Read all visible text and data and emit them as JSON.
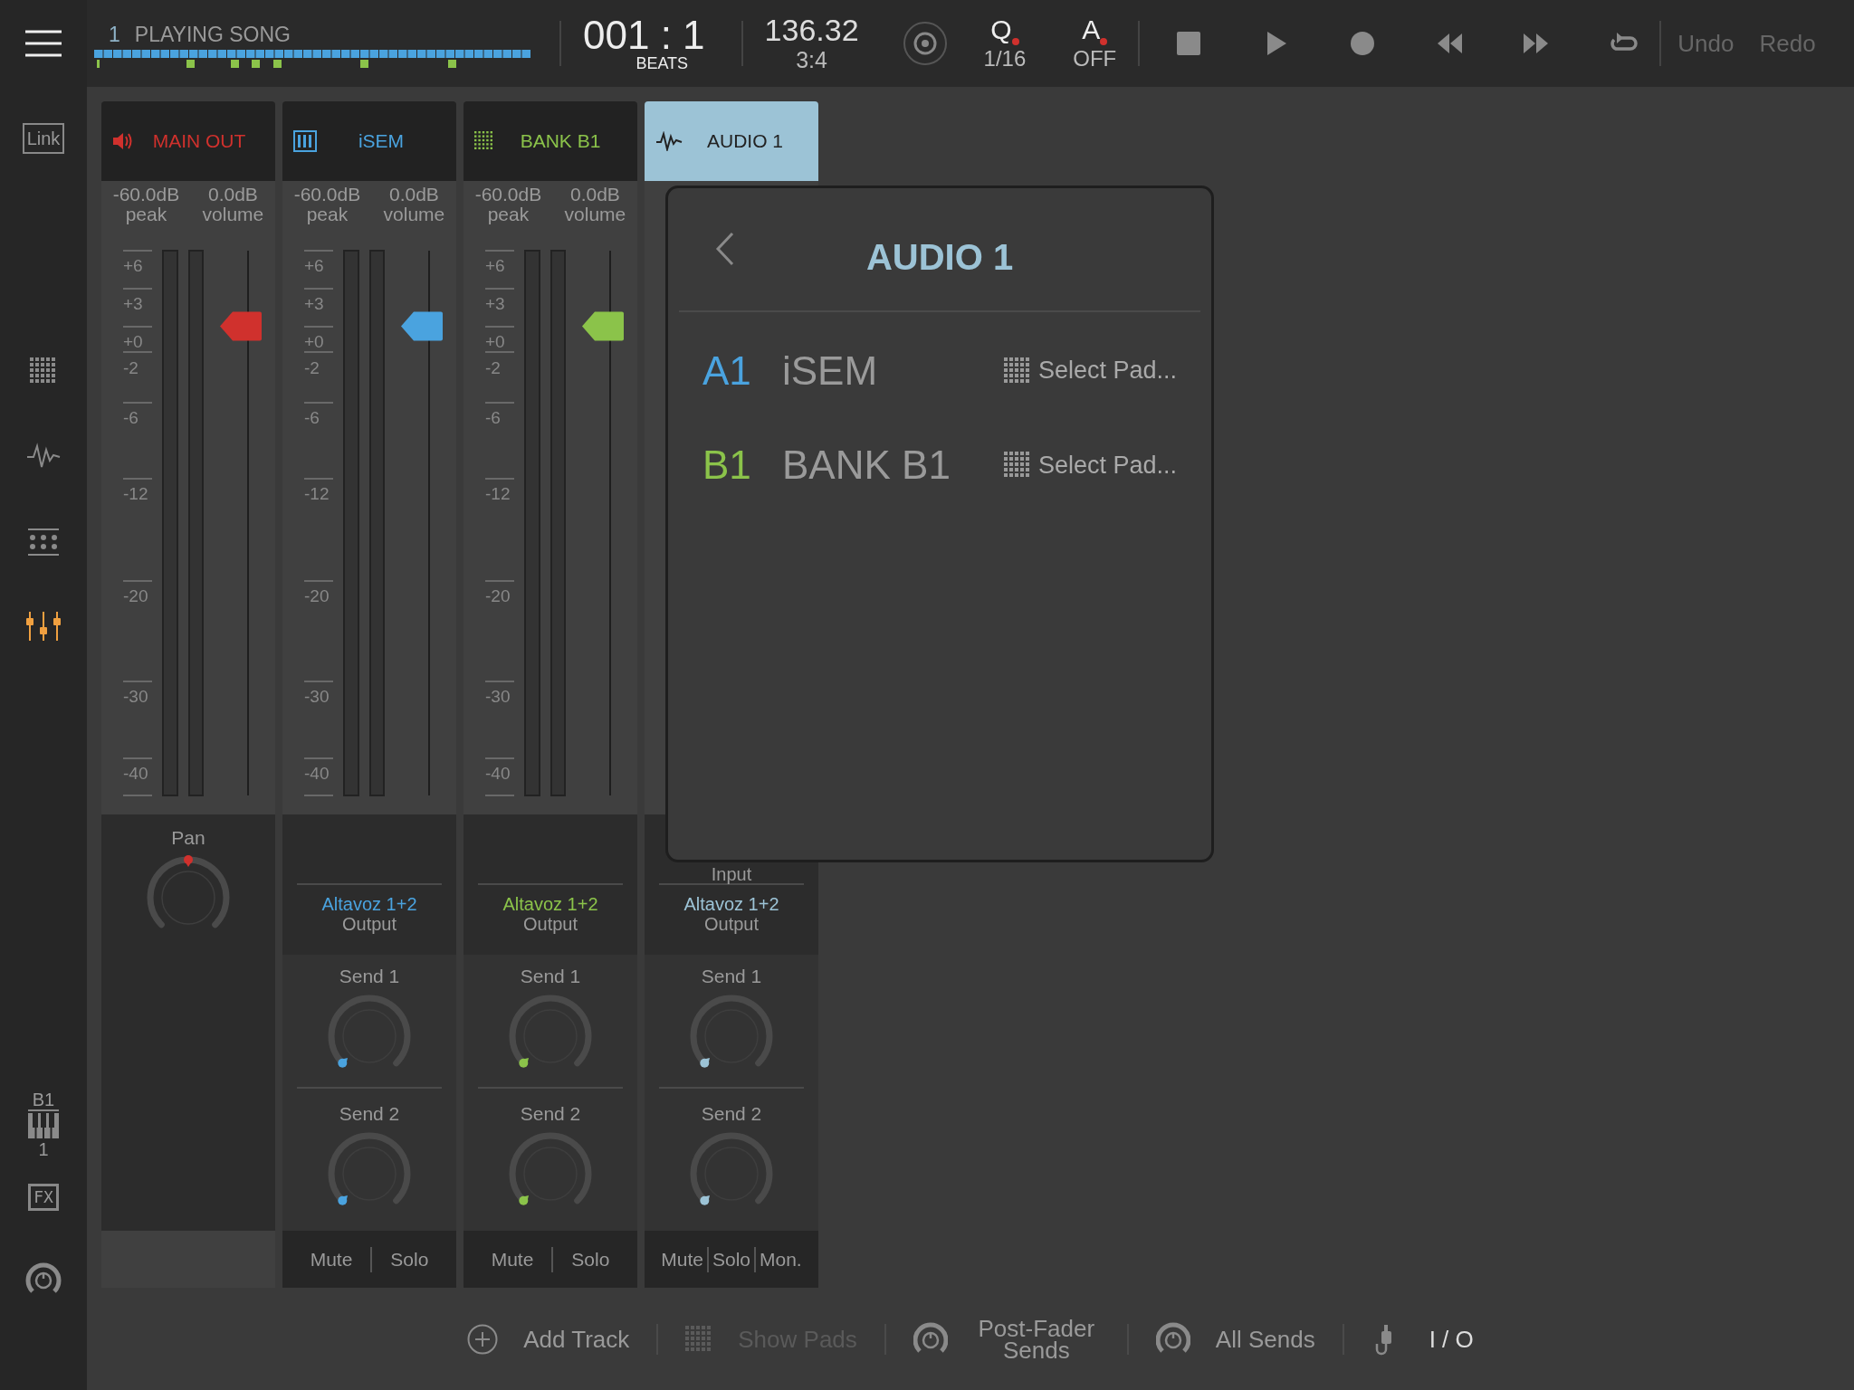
{
  "top_bar": {
    "song_number": "1",
    "song_title": "PLAYING SONG",
    "position": "001 : 1",
    "position_unit": "BEATS",
    "tempo": "136.32",
    "signature": "3:4",
    "quantize": {
      "label": "Q",
      "value": "1/16"
    },
    "automation": {
      "label": "A",
      "value": "OFF"
    },
    "undo": {
      "label": "Undo",
      "disabled": true
    },
    "redo": {
      "label": "Redo",
      "disabled": true
    }
  },
  "sidebar": {
    "link": "Link",
    "items": [
      {
        "kind": "pads",
        "selected": false
      },
      {
        "kind": "wave",
        "selected": false
      },
      {
        "kind": "sequencer",
        "selected": false
      },
      {
        "kind": "mixer",
        "selected": true
      }
    ],
    "instrument": {
      "bank": "B1",
      "number": "1"
    },
    "fx": "FX"
  },
  "strips": [
    {
      "name": "MAIN OUT",
      "kind": "master",
      "color": "#d0312d",
      "selected": false,
      "peak": "-60.0dB",
      "peak_label": "peak",
      "volume": "0.0dB",
      "volume_label": "volume",
      "scale": [
        "+6",
        "+3",
        "+0",
        "-2",
        "-6",
        "-12",
        "-20",
        "-30",
        "-40"
      ],
      "level": 0.86,
      "pan": {
        "label": "Pan",
        "level": 0.5
      }
    },
    {
      "name": "iSEM",
      "kind": "instrument",
      "color": "#4aa3df",
      "selected": false,
      "peak": "-60.0dB",
      "peak_label": "peak",
      "volume": "0.0dB",
      "volume_label": "volume",
      "scale": [
        "+6",
        "+3",
        "+0",
        "-2",
        "-6",
        "-12",
        "-20",
        "-30",
        "-40"
      ],
      "level": 0.86,
      "output": {
        "value": "Altavoz 1+2",
        "label": "Output"
      },
      "sends": [
        {
          "label": "Send 1",
          "level": 0
        },
        {
          "label": "Send 2",
          "level": 0
        }
      ],
      "buttons": [
        "Mute",
        "Solo"
      ]
    },
    {
      "name": "BANK B1",
      "kind": "pads",
      "color": "#8bc34a",
      "selected": false,
      "peak": "-60.0dB",
      "peak_label": "peak",
      "volume": "0.0dB",
      "volume_label": "volume",
      "scale": [
        "+6",
        "+3",
        "+0",
        "-2",
        "-6",
        "-12",
        "-20",
        "-30",
        "-40"
      ],
      "level": 0.86,
      "output": {
        "value": "Altavoz 1+2",
        "label": "Output"
      },
      "sends": [
        {
          "label": "Send 1",
          "level": 0
        },
        {
          "label": "Send 2",
          "level": 0
        }
      ],
      "buttons": [
        "Mute",
        "Solo"
      ]
    },
    {
      "name": "AUDIO 1",
      "kind": "audio",
      "color": "#9cc3d6",
      "selected": true,
      "input_label": "Input",
      "output": {
        "value": "Altavoz 1+2",
        "label": "Output"
      },
      "sends": [
        {
          "label": "Send 1",
          "level": 0
        },
        {
          "label": "Send 2",
          "level": 0
        }
      ],
      "buttons": [
        "Mute",
        "Solo",
        "Mon."
      ]
    }
  ],
  "popup": {
    "title": "AUDIO 1",
    "rows": [
      {
        "slot": "A1",
        "color": "#4aa3df",
        "name": "iSEM",
        "action": "Select Pad..."
      },
      {
        "slot": "B1",
        "color": "#8bc34a",
        "name": "BANK B1",
        "action": "Select Pad..."
      }
    ]
  },
  "bottom_bar": [
    {
      "kind": "add",
      "label": "Add Track",
      "disabled": false
    },
    {
      "kind": "pads",
      "label": "Show Pads",
      "disabled": true
    },
    {
      "kind": "knob",
      "label": "Post-Fader Sends",
      "disabled": false
    },
    {
      "kind": "knob",
      "label": "All Sends",
      "disabled": false
    },
    {
      "kind": "io",
      "label": "I / O",
      "disabled": false
    }
  ]
}
